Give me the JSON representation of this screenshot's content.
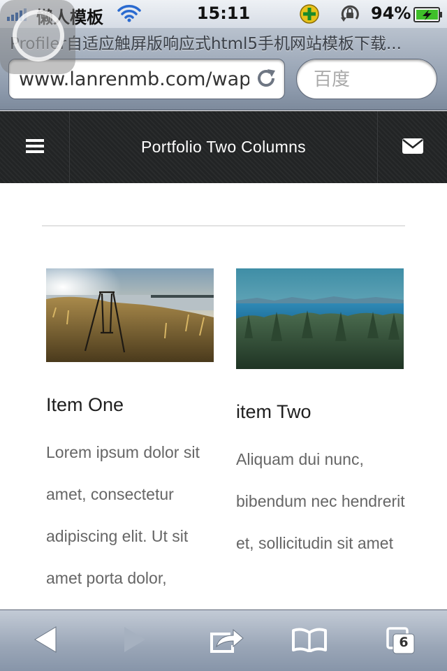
{
  "status_bar": {
    "carrier": "懒人模板",
    "time": "15:11",
    "battery": "94%"
  },
  "browser": {
    "page_title": "Profiler自适应触屏版响应式html5手机网站模板下载...",
    "url": "www.lanrenmb.com/wap",
    "search_placeholder": "百度",
    "tab_count": "6"
  },
  "header": {
    "title": "Portfolio Two Columns",
    "menu_icon": "hamburger-menu-icon",
    "mail_icon": "envelope-icon"
  },
  "portfolio": {
    "items": [
      {
        "title": "Item One",
        "text": "Lorem ipsum dolor sit amet, consectetur adipiscing elit. Ut sit amet porta dolor,",
        "image": "grassland-lake-swing-photo"
      },
      {
        "title": "item Two",
        "text": "Aliquam dui nunc, bibendum nec hendrerit et, sollicitudin sit amet",
        "image": "forest-sea-mountains-photo"
      }
    ]
  },
  "toolbar": {
    "icons": [
      "back-arrow-icon",
      "forward-arrow-icon",
      "share-icon",
      "bookmarks-icon",
      "tabs-icon"
    ]
  },
  "colors": {
    "header_bg": "#222425",
    "text_muted": "#666666",
    "ios_chrome": "#8d9aac"
  }
}
